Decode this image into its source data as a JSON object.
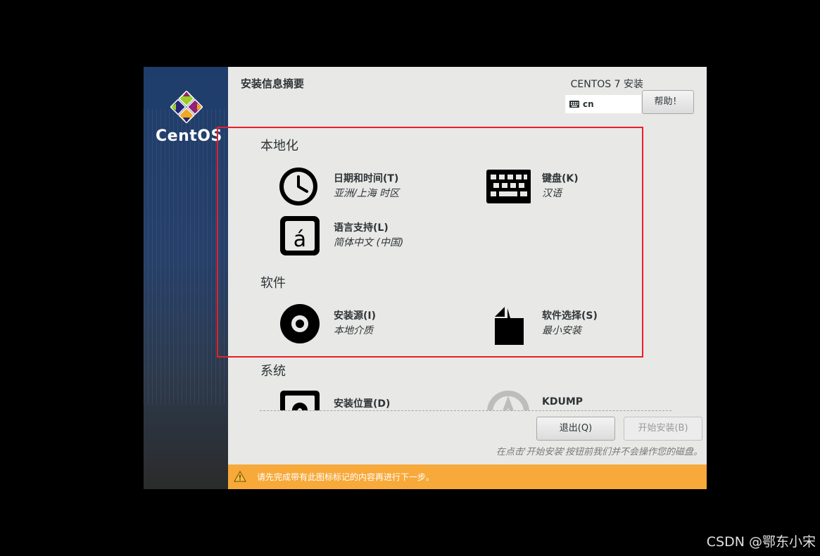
{
  "sidebar": {
    "brand": "CentOS"
  },
  "header": {
    "page_title": "安装信息摘要",
    "product_title": "CENTOS 7 安装",
    "keyboard_layout": "cn",
    "help_label": "帮助！"
  },
  "categories": [
    {
      "name": "本地化"
    },
    {
      "name": "软件"
    },
    {
      "name": "系统"
    }
  ],
  "spokes": {
    "datetime": {
      "title": "日期和时间(T)",
      "status": "亚洲/上海 时区",
      "icon": "clock-icon"
    },
    "keyboard": {
      "title": "键盘(K)",
      "status": "汉语",
      "icon": "keyboard-icon"
    },
    "language": {
      "title": "语言支持(L)",
      "status": "简体中文 (中国)",
      "icon": "language-icon"
    },
    "source": {
      "title": "安装源(I)",
      "status": "本地介质",
      "icon": "disc-icon"
    },
    "software": {
      "title": "软件选择(S)",
      "status": "最小安装",
      "icon": "package-icon"
    },
    "storage": {
      "title": "安装位置(D)",
      "icon": "harddisk-icon"
    },
    "kdump": {
      "title": "KDUMP",
      "icon": "kdump-icon"
    }
  },
  "footer": {
    "quit_label": "退出(Q)",
    "begin_label": "开始安装(B)",
    "note": "在点击'开始安装'按钮前我们并不会操作您的磁盘。"
  },
  "warning": {
    "text": "请先完成带有此图标标记的内容再进行下一步。",
    "icon": "warning-icon",
    "color": "#f7a93a"
  },
  "annotation": {
    "color": "#e8202a"
  },
  "watermark": "CSDN @鄂东小宋"
}
